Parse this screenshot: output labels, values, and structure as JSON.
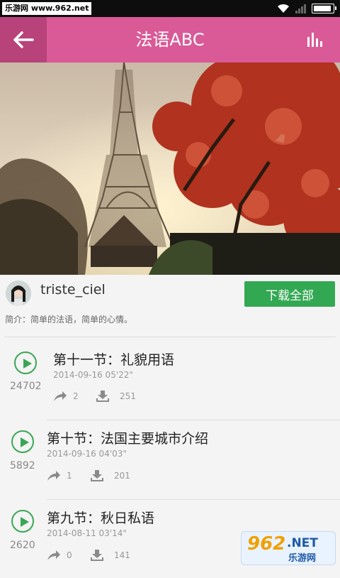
{
  "status_bar": {
    "watermark": "乐游网 www.962.net"
  },
  "app_bar": {
    "title": "法语ABC",
    "back_icon": "back-arrow-icon",
    "menu_icon": "equalizer-icon",
    "color": "#d95a97",
    "back_color": "#b8427a"
  },
  "profile": {
    "username": "triste_ciel",
    "download_all": "下载全部",
    "intro": "简介：简单的法语，简单的心情。"
  },
  "lessons": [
    {
      "title": "第十一节：礼貌用语",
      "date": "2014-09-16 05'22\"",
      "plays": "24702",
      "shares": "2",
      "downloads": "251"
    },
    {
      "title": "第十节：法国主要城市介绍",
      "date": "2014-09-16 04'03\"",
      "plays": "5892",
      "shares": "1",
      "downloads": "201"
    },
    {
      "title": "第九节：秋日私语",
      "date": "2014-08-11 03'14\"",
      "plays": "2620",
      "shares": "0",
      "downloads": "141"
    }
  ],
  "watermark_br": {
    "logo": "962",
    "net": ".NET",
    "cn": "乐游网"
  },
  "accent_green": "#33a853"
}
